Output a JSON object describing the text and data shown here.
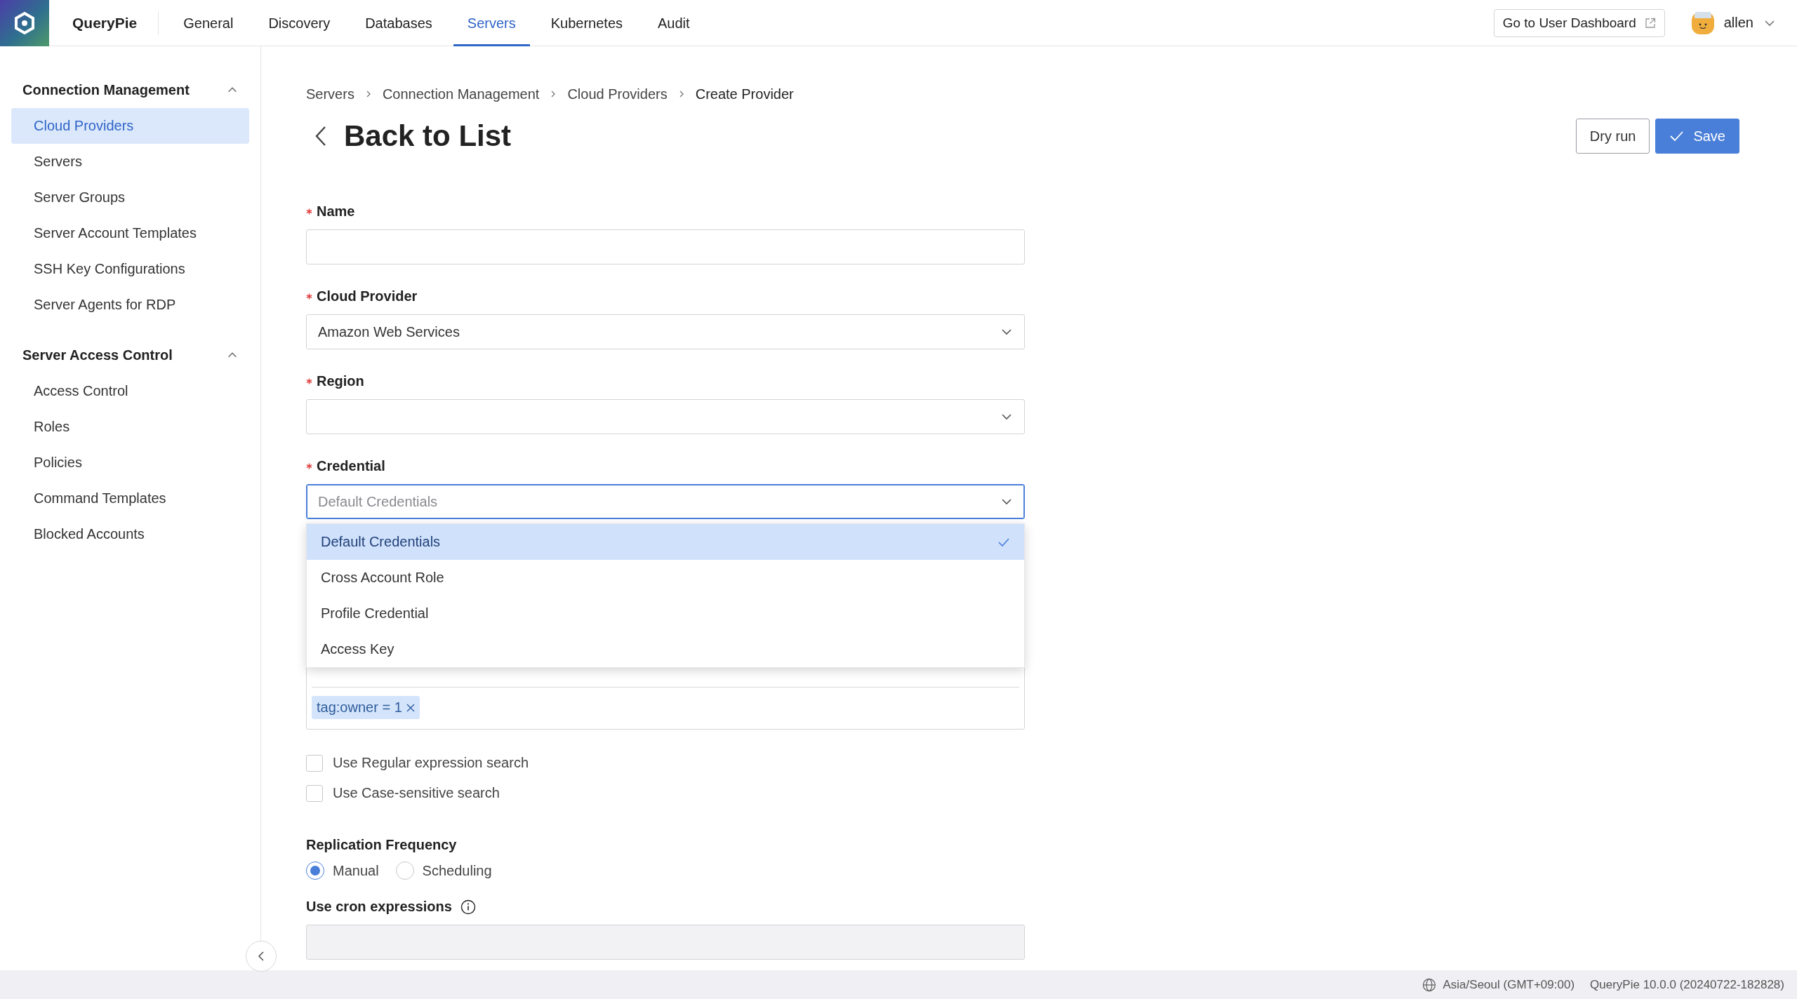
{
  "app": {
    "name": "QueryPie"
  },
  "nav": [
    {
      "label": "General",
      "selected": false
    },
    {
      "label": "Discovery",
      "selected": false
    },
    {
      "label": "Databases",
      "selected": false
    },
    {
      "label": "Servers",
      "selected": true
    },
    {
      "label": "Kubernetes",
      "selected": false
    },
    {
      "label": "Audit",
      "selected": false
    }
  ],
  "header_actions": {
    "dashboard_link": "Go to User Dashboard",
    "user": "allen"
  },
  "sidebar": {
    "sections": [
      {
        "title": "Connection Management",
        "expanded": true,
        "items": [
          {
            "label": "Cloud Providers",
            "selected": true
          },
          {
            "label": "Servers",
            "selected": false
          },
          {
            "label": "Server Groups",
            "selected": false
          },
          {
            "label": "Server Account Templates",
            "selected": false
          },
          {
            "label": "SSH Key Configurations",
            "selected": false
          },
          {
            "label": "Server Agents for RDP",
            "selected": false
          }
        ]
      },
      {
        "title": "Server Access Control",
        "expanded": true,
        "items": [
          {
            "label": "Access Control",
            "selected": false
          },
          {
            "label": "Roles",
            "selected": false
          },
          {
            "label": "Policies",
            "selected": false
          },
          {
            "label": "Command Templates",
            "selected": false
          },
          {
            "label": "Blocked Accounts",
            "selected": false
          }
        ]
      }
    ]
  },
  "breadcrumb": [
    "Servers",
    "Connection Management",
    "Cloud Providers",
    "Create Provider"
  ],
  "page": {
    "back_label": "Back to List",
    "buttons": [
      {
        "label": "Dry run",
        "kind": "secondary"
      },
      {
        "label": "Save",
        "kind": "primary"
      }
    ]
  },
  "form": {
    "fields": [
      {
        "label": "Name",
        "required": true,
        "kind": "text"
      },
      {
        "label": "Cloud Provider",
        "required": true,
        "kind": "select",
        "value": "Amazon Web Services"
      },
      {
        "label": "Region",
        "required": true,
        "kind": "select"
      },
      {
        "label": "Credential",
        "required": true,
        "kind": "select",
        "placeholder": "Default Credentials",
        "focused": true
      }
    ],
    "credential_options": [
      {
        "label": "Default Credentials",
        "selected": true
      },
      {
        "label": "Cross Account Role",
        "selected": false
      },
      {
        "label": "Profile Credential",
        "selected": false
      },
      {
        "label": "Access Key",
        "selected": false
      }
    ],
    "tags": [
      "tag:owner = 1"
    ],
    "search_options": [
      {
        "label": "Use Regular expression search",
        "checked": false
      },
      {
        "label": "Use Case-sensitive search",
        "checked": false
      }
    ],
    "replication": {
      "label": "Replication Frequency",
      "options": [
        {
          "label": "Manual",
          "selected": true
        },
        {
          "label": "Scheduling",
          "selected": false
        }
      ]
    },
    "cron": {
      "label": "Use cron expressions",
      "disabled": true
    }
  },
  "status_bar": {
    "timezone": "Asia/Seoul (GMT+09:00)",
    "version": "QueryPie 10.0.0 (20240722-182828)"
  }
}
